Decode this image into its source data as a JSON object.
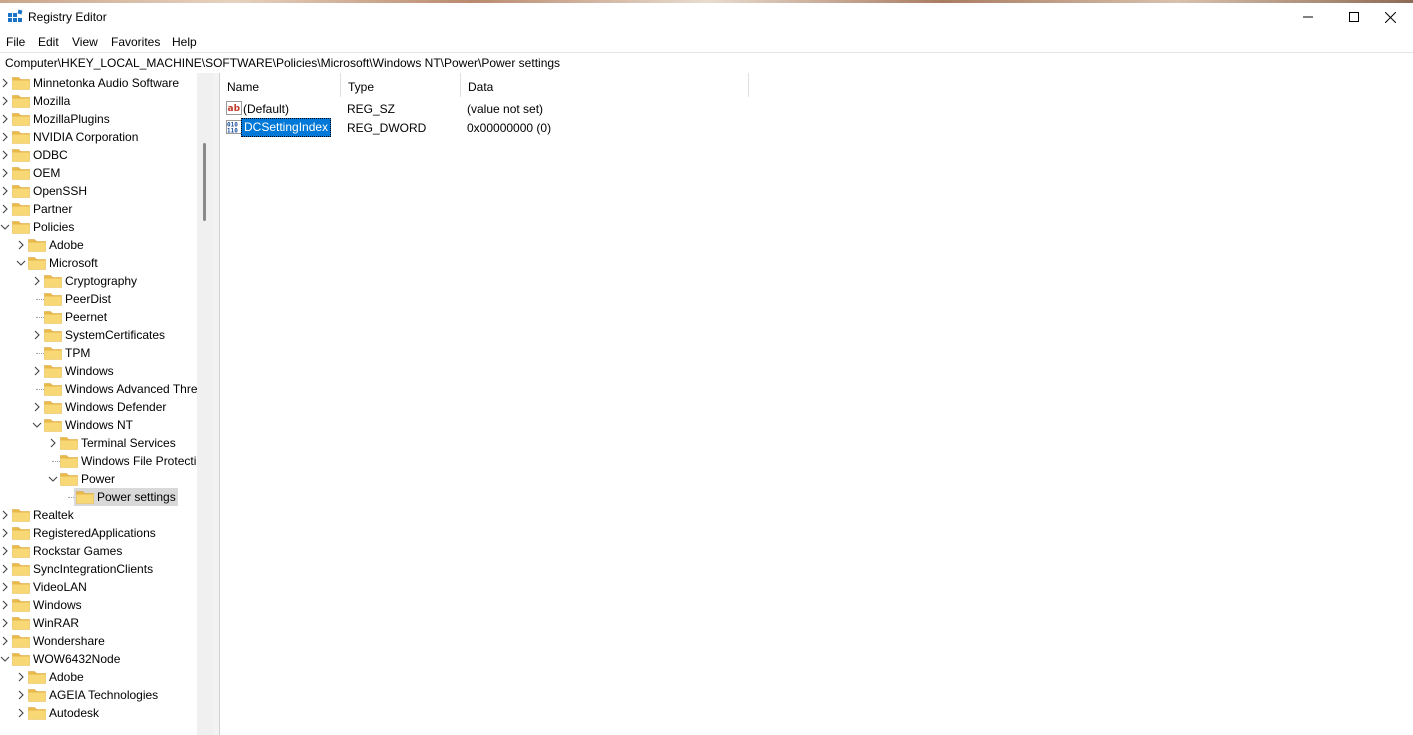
{
  "window": {
    "title": "Registry Editor",
    "controls": [
      "minimize",
      "maximize",
      "close"
    ]
  },
  "menu": [
    "File",
    "Edit",
    "View",
    "Favorites",
    "Help"
  ],
  "address": "Computer\\HKEY_LOCAL_MACHINE\\SOFTWARE\\Policies\\Microsoft\\Windows NT\\Power\\Power settings",
  "tree": [
    {
      "label": "Minnetonka Audio Software",
      "level": 0,
      "exp": "c"
    },
    {
      "label": "Mozilla",
      "level": 0,
      "exp": "c"
    },
    {
      "label": "MozillaPlugins",
      "level": 0,
      "exp": "c"
    },
    {
      "label": "NVIDIA Corporation",
      "level": 0,
      "exp": "c"
    },
    {
      "label": "ODBC",
      "level": 0,
      "exp": "c"
    },
    {
      "label": "OEM",
      "level": 0,
      "exp": "c"
    },
    {
      "label": "OpenSSH",
      "level": 0,
      "exp": "c"
    },
    {
      "label": "Partner",
      "level": 0,
      "exp": "c"
    },
    {
      "label": "Policies",
      "level": 0,
      "exp": "e"
    },
    {
      "label": "Adobe",
      "level": 1,
      "exp": "c"
    },
    {
      "label": "Microsoft",
      "level": 1,
      "exp": "e"
    },
    {
      "label": "Cryptography",
      "level": 2,
      "exp": "c"
    },
    {
      "label": "PeerDist",
      "level": 2,
      "exp": "n"
    },
    {
      "label": "Peernet",
      "level": 2,
      "exp": "n"
    },
    {
      "label": "SystemCertificates",
      "level": 2,
      "exp": "c"
    },
    {
      "label": "TPM",
      "level": 2,
      "exp": "n"
    },
    {
      "label": "Windows",
      "level": 2,
      "exp": "c"
    },
    {
      "label": "Windows Advanced Thre",
      "level": 2,
      "exp": "n"
    },
    {
      "label": "Windows Defender",
      "level": 2,
      "exp": "c"
    },
    {
      "label": "Windows NT",
      "level": 2,
      "exp": "e"
    },
    {
      "label": "Terminal Services",
      "level": 3,
      "exp": "c"
    },
    {
      "label": "Windows File Protecti",
      "level": 3,
      "exp": "n"
    },
    {
      "label": "Power",
      "level": 3,
      "exp": "e"
    },
    {
      "label": "Power settings",
      "level": 4,
      "exp": "n",
      "selected": true
    },
    {
      "label": "Realtek",
      "level": 0,
      "exp": "c"
    },
    {
      "label": "RegisteredApplications",
      "level": 0,
      "exp": "c"
    },
    {
      "label": "Rockstar Games",
      "level": 0,
      "exp": "c"
    },
    {
      "label": "SyncIntegrationClients",
      "level": 0,
      "exp": "c"
    },
    {
      "label": "VideoLAN",
      "level": 0,
      "exp": "c"
    },
    {
      "label": "Windows",
      "level": 0,
      "exp": "c"
    },
    {
      "label": "WinRAR",
      "level": 0,
      "exp": "c"
    },
    {
      "label": "Wondershare",
      "level": 0,
      "exp": "c"
    },
    {
      "label": "WOW6432Node",
      "level": 0,
      "exp": "e"
    },
    {
      "label": "Adobe",
      "level": 1,
      "exp": "c"
    },
    {
      "label": "AGEIA Technologies",
      "level": 1,
      "exp": "c"
    },
    {
      "label": "Autodesk",
      "level": 1,
      "exp": "c"
    }
  ],
  "list": {
    "columns": [
      "Name",
      "Type",
      "Data"
    ],
    "rows": [
      {
        "name": "(Default)",
        "type": "REG_SZ",
        "data": "(value not set)",
        "icon": "string-value-icon",
        "selected": false
      },
      {
        "name": "DCSettingIndex",
        "type": "REG_DWORD",
        "data": "0x00000000 (0)",
        "icon": "binary-value-icon",
        "selected": true
      }
    ]
  },
  "colors": {
    "selection": "#0078d7",
    "folder": "#f8d775",
    "tree_selection": "#d9d9d9"
  }
}
